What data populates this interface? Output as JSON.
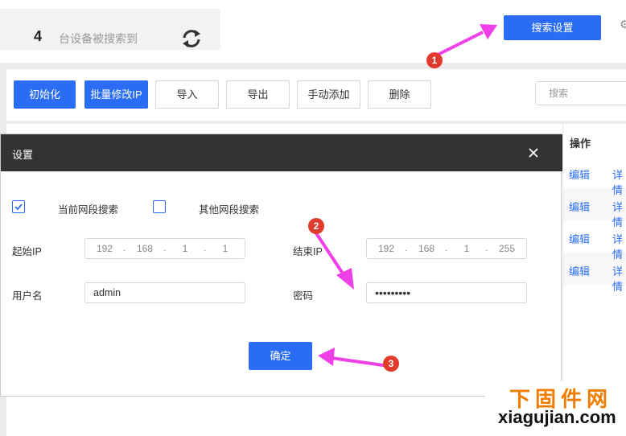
{
  "header": {
    "device_count": "4",
    "device_count_text": "台设备被搜索到",
    "search_settings_label": "搜索设置"
  },
  "toolbar": {
    "init_label": "初始化",
    "batch_modify_ip_label": "批量修改IP",
    "import_label": "导入",
    "export_label": "导出",
    "manual_add_label": "手动添加",
    "delete_label": "删除",
    "search_placeholder": "搜索"
  },
  "table": {
    "operation_header": "操作",
    "rows": [
      {
        "edit": "编辑",
        "detail": "详情"
      },
      {
        "edit": "编辑",
        "detail": "详情"
      },
      {
        "edit": "编辑",
        "detail": "详情"
      },
      {
        "edit": "编辑",
        "detail": "详情"
      }
    ]
  },
  "modal": {
    "title": "设置",
    "current_segment_label": "当前网段搜索",
    "current_segment_checked": true,
    "other_segment_label": "其他网段搜索",
    "other_segment_checked": false,
    "start_ip_label": "起始IP",
    "start_ip": [
      "192",
      "168",
      "1",
      "1"
    ],
    "end_ip_label": "结束IP",
    "end_ip": [
      "192",
      "168",
      "1",
      "255"
    ],
    "username_label": "用户名",
    "username_value": "admin",
    "password_label": "密码",
    "password_value": "•••••••••",
    "confirm_label": "确定"
  },
  "annotations": {
    "badge_1": "1",
    "badge_2": "2",
    "badge_3": "3",
    "arrow_color": "#ee40e6",
    "badge_color": "#e03b2c"
  },
  "watermark": {
    "cn": "下固件网",
    "en": "xiagujian.com"
  },
  "colors": {
    "primary": "#2b6cf5",
    "modal_header": "#333333"
  }
}
